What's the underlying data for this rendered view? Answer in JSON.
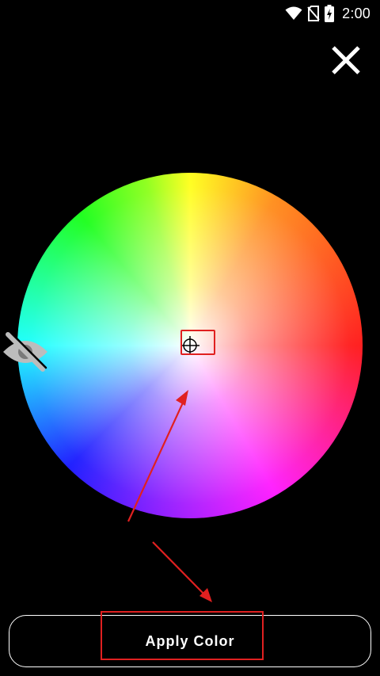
{
  "status_bar": {
    "time": "2:00",
    "icons": [
      "wifi-icon",
      "no-sim-icon",
      "battery-charging-icon"
    ]
  },
  "header": {
    "close_icon": "close-icon"
  },
  "picker": {
    "wheel": "hue-saturation-color-wheel",
    "selector_icon": "crosshair-icon",
    "visibility_icon": "eye-off-icon",
    "selected_color": "#ffffff"
  },
  "annotations": {
    "highlight_color": "#e02020",
    "arrow_color": "#e02020"
  },
  "footer": {
    "apply_label": "Apply Color"
  },
  "colors": {
    "background": "#000000",
    "foreground": "#ffffff"
  }
}
